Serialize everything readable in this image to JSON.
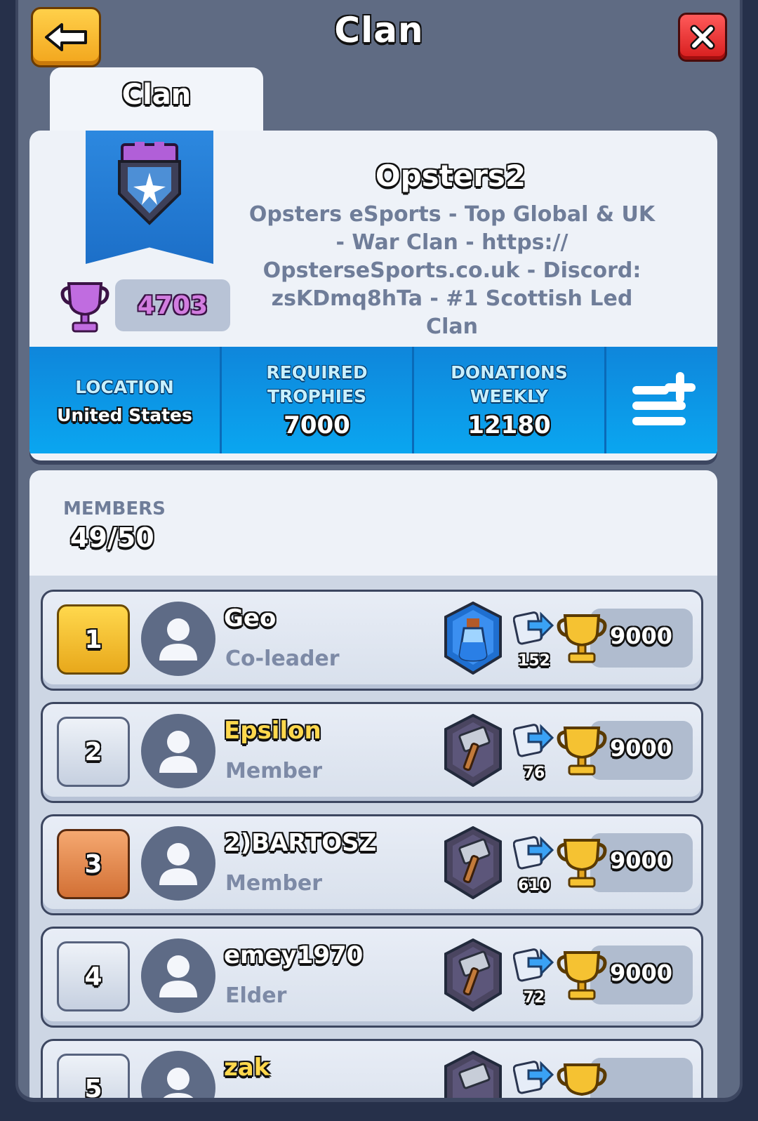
{
  "header": {
    "title": "Clan"
  },
  "tabs": [
    {
      "label": "Clan"
    }
  ],
  "clan": {
    "name": "Opsters2",
    "description_lines": [
      "Opsters eSports - Top Global & UK",
      "- War Clan - https://",
      "OpsterseSports.co.uk - Discord:",
      "zsKDmq8hTa - #1 Scottish Led Clan"
    ],
    "score": "4703",
    "badge_icon": "shield-star-icon"
  },
  "stats": {
    "location_label": "LOCATION",
    "location_value": "United States",
    "required_label_1": "REQUIRED",
    "required_label_2": "TROPHIES",
    "required_value": "7000",
    "donations_label_1": "DONATIONS",
    "donations_label_2": "WEEKLY",
    "donations_value": "12180"
  },
  "members": {
    "label": "MEMBERS",
    "count": "49/50",
    "rows": [
      {
        "rank": "1",
        "name": "Geo",
        "role": "Co-leader",
        "arena": "elixir-arena-icon",
        "donations": "152",
        "trophies": "9000"
      },
      {
        "rank": "2",
        "name": "Epsilon",
        "role": "Member",
        "arena": "hammer-arena-icon",
        "donations": "76",
        "trophies": "9000"
      },
      {
        "rank": "3",
        "name": "2)BARTOSZ",
        "role": "Member",
        "arena": "hammer-arena-icon",
        "donations": "610",
        "trophies": "9000"
      },
      {
        "rank": "4",
        "name": "emey1970",
        "role": "Elder",
        "arena": "hammer-arena-icon",
        "donations": "72",
        "trophies": "9000"
      },
      {
        "rank": "5",
        "name": "zak",
        "role": "",
        "arena": "hammer-arena-icon",
        "donations": "",
        "trophies": ""
      }
    ]
  },
  "colors": {
    "accent_blue": "#0f86db",
    "gold": "#ffd84d",
    "purple": "#d27de0"
  }
}
